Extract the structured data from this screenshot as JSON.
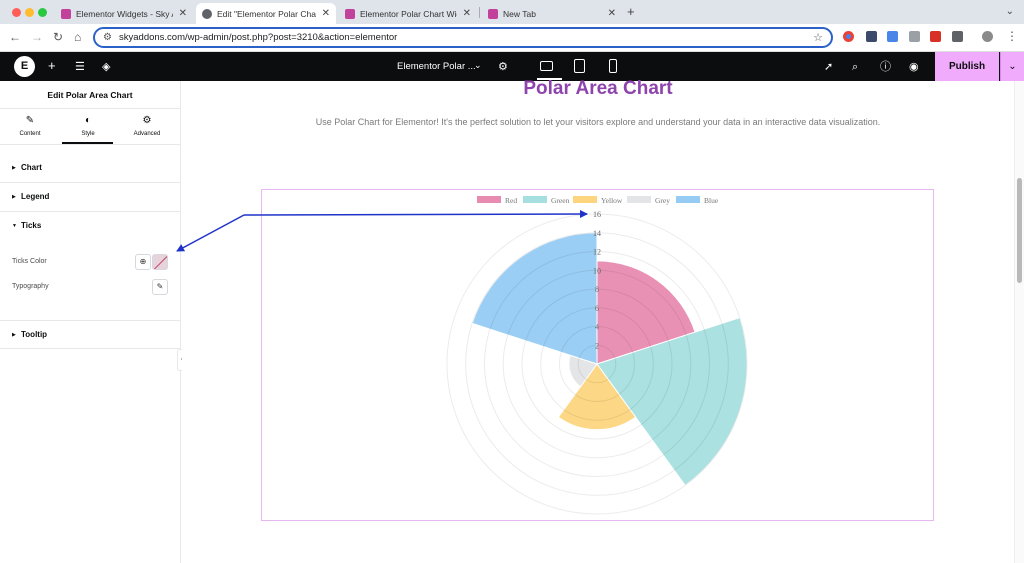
{
  "browser": {
    "tabs": [
      {
        "label": "Elementor Widgets - Sky Add",
        "favicon_color": "#c2419a",
        "active": false
      },
      {
        "label": "Edit \"Elementor Polar Chart W",
        "favicon_color": "#5f6368",
        "active": true
      },
      {
        "label": "Elementor Polar Chart Widget",
        "favicon_color": "#c2419a",
        "active": false
      },
      {
        "label": "New Tab",
        "favicon_color": "#c2419a",
        "active": false
      }
    ],
    "close_glyph": "✕",
    "new_tab_glyph": "+",
    "url": "skyaddons.com/wp-admin/post.php?post=3210&action=elementor"
  },
  "elementor_bar": {
    "logo_glyph": "E",
    "document_title": "Elementor Polar ...",
    "publish_label": "Publish"
  },
  "panel": {
    "title": "Edit Polar Area Chart",
    "tabs": [
      {
        "label": "Content",
        "icon": "pencil-icon"
      },
      {
        "label": "Style",
        "icon": "contrast-icon",
        "active": true
      },
      {
        "label": "Advanced",
        "icon": "gear-icon"
      }
    ],
    "sections": {
      "chart": "Chart",
      "legend": "Legend",
      "ticks": "Ticks",
      "tooltip": "Tooltip"
    },
    "controls": {
      "ticks_color": "Ticks Color",
      "typography": "Typography"
    }
  },
  "page": {
    "title": "Polar Area Chart",
    "subtitle": "Use Polar Chart for Elementor! It's the perfect solution to let your visitors explore and understand your data in an interactive data visualization."
  },
  "chart_data": {
    "type": "polarArea",
    "title": "",
    "categories": [
      "Red",
      "Green",
      "Yellow",
      "Grey",
      "Blue"
    ],
    "values": [
      11,
      16,
      7,
      3,
      14
    ],
    "colors": [
      "#e88bb0",
      "#a6dfdf",
      "#fcd57e",
      "#e3e4e6",
      "#96cbf3"
    ],
    "r_ticks": [
      2,
      4,
      6,
      8,
      10,
      12,
      14,
      16
    ],
    "r_max": 16,
    "legend_position": "top",
    "grid": true
  },
  "annotation": {
    "arrow_color": "#1f33c9"
  }
}
